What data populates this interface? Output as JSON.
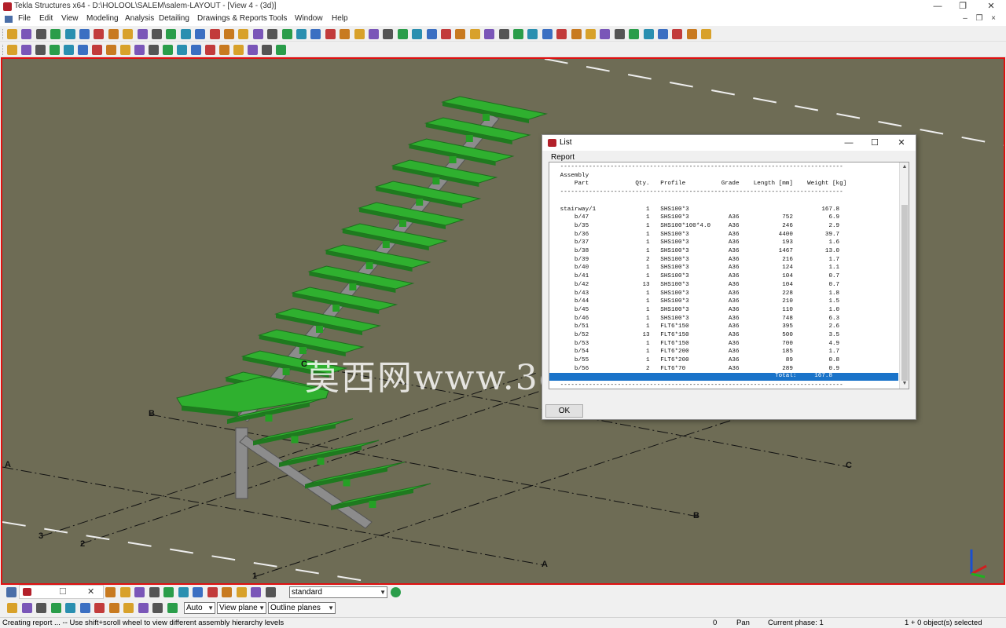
{
  "window": {
    "title": "Tekla Structures x64 - D:\\HOLOOL\\SALEM\\salem-LAYOUT - [View 4 - (3d)]",
    "minimize": "—",
    "restore": "❐",
    "close": "✕"
  },
  "menu": {
    "items": [
      "File",
      "Edit",
      "View",
      "Modeling",
      "Analysis",
      "Detailing",
      "Drawings & Reports",
      "Tools",
      "Window",
      "Help"
    ],
    "mdi_minimize": "–",
    "mdi_restore": "❐",
    "mdi_close": "×"
  },
  "viewport": {
    "grid_labels": [
      "A",
      "B",
      "C",
      "A",
      "B",
      "C",
      "1",
      "2",
      "3"
    ],
    "watermark": "莫西网www.3dmox.com",
    "accent_color": "#e01010",
    "background_color": "#6e6c55",
    "steel_color": "#2fb02f"
  },
  "dialog": {
    "title": "List",
    "menu": "Report",
    "ok_label": "OK",
    "report_lines": [
      "   -------------------------------------------------------------------------------",
      "   Assembly",
      "       Part             Qty.   Profile          Grade    Length [mm]    Weight [kg]",
      "   -------------------------------------------------------------------------------",
      "",
      "   stairway/1              1   SHS100*3                                     167.8",
      "       b/47                1   SHS100*3           A36            752          6.9",
      "       b/35                1   SHS100*100*4.0     A36            246          2.9",
      "       b/36                1   SHS100*3           A36           4400         39.7",
      "       b/37                1   SHS100*3           A36            193          1.6",
      "       b/38                1   SHS100*3           A36           1467         13.0",
      "       b/39                2   SHS100*3           A36            216          1.7",
      "       b/40                1   SHS100*3           A36            124          1.1",
      "       b/41                1   SHS100*3           A36            104          0.7",
      "       b/42               13   SHS100*3           A36            104          0.7",
      "       b/43                1   SHS100*3           A36            228          1.8",
      "       b/44                1   SHS100*3           A36            210          1.5",
      "       b/45                1   SHS100*3           A36            110          1.0",
      "       b/46                1   SHS100*3           A36            748          6.3",
      "       b/51                1   FLT6*150           A36            395          2.6",
      "       b/52               13   FLT6*150           A36            500          3.5",
      "       b/53                1   FLT6*150           A36            700          4.9",
      "       b/54                1   FLT6*200           A36            185          1.7",
      "       b/55                1   FLT6*200           A36             89          0.8",
      "       b/56                2   FLT6*70            A36            289          0.9",
      "   -------------------------------------------------------------------------------"
    ],
    "total_line": "                                                               Total:     167.8",
    "after_total": "   -------------------------------------------------------------------------------"
  },
  "bottom": {
    "view_tab_close": "✕",
    "view_tab_restore": "☐",
    "filter_value": "standard",
    "snap_mode": "Auto",
    "plane": "View plane",
    "outline": "Outline planes"
  },
  "status": {
    "message": "Creating report ... -- Use shift+scroll wheel to view different assembly hierarchy levels",
    "count": "0",
    "mode": "Pan",
    "phase": "Current phase: 1",
    "selection": "1 + 0 object(s) selected"
  }
}
